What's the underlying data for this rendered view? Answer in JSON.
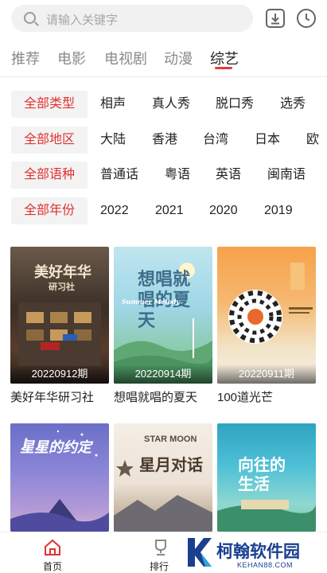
{
  "search": {
    "placeholder": "请输入关键字"
  },
  "header_icons": [
    "download-icon",
    "history-clock-icon"
  ],
  "tabs": [
    {
      "label": "推荐",
      "active": false
    },
    {
      "label": "电影",
      "active": false
    },
    {
      "label": "电视剧",
      "active": false
    },
    {
      "label": "动漫",
      "active": false
    },
    {
      "label": "综艺",
      "active": true
    }
  ],
  "filters": {
    "type": {
      "head": "全部类型",
      "options": [
        "相声",
        "真人秀",
        "脱口秀",
        "选秀"
      ]
    },
    "region": {
      "head": "全部地区",
      "options": [
        "大陆",
        "香港",
        "台湾",
        "日本",
        "欧"
      ]
    },
    "language": {
      "head": "全部语种",
      "options": [
        "普通话",
        "粤语",
        "英语",
        "闽南语"
      ]
    },
    "year": {
      "head": "全部年份",
      "options": [
        "2022",
        "2021",
        "2020",
        "2019"
      ]
    }
  },
  "shows": [
    {
      "title": "美好年华研习社",
      "episode": "20220912期",
      "poster_text": "美好年华",
      "poster_sub": "研习社"
    },
    {
      "title": "想唱就唱的夏天",
      "episode": "20220914期",
      "poster_text": "想唱就唱的夏天",
      "poster_sub": "Summer Melody"
    },
    {
      "title": "100道光芒",
      "episode": "20220911期",
      "poster_text": "",
      "poster_sub": ""
    },
    {
      "title": "",
      "episode": "",
      "poster_text": "星星的约定",
      "poster_sub": ""
    },
    {
      "title": "",
      "episode": "",
      "poster_text": "星月对话",
      "poster_sub": "STAR MOON"
    },
    {
      "title": "",
      "episode": "",
      "poster_text": "向往的生活",
      "poster_sub": ""
    }
  ],
  "bottom_nav": [
    {
      "label": "首页",
      "icon": "home-icon",
      "active": true
    },
    {
      "label": "排行",
      "icon": "trophy-icon",
      "active": false
    }
  ],
  "watermark": {
    "name": "柯翰软件园",
    "url": "KEHAN88.COM"
  },
  "colors": {
    "accent": "#e0322f",
    "tab_indicator": "#e33b3b",
    "filter_bg": "#f3f3f3",
    "watermark": "#1a3f8f"
  }
}
